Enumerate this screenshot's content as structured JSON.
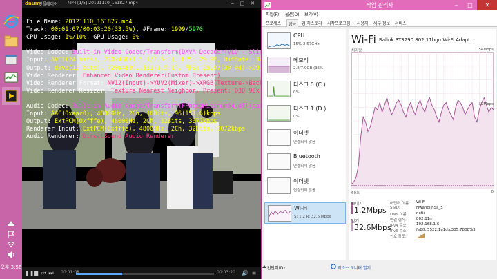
{
  "taskbar": {
    "clock": "오후 3:56"
  },
  "player": {
    "logo": "daum",
    "app_name": "팟플레이어",
    "format": "MP4",
    "file_title": "[1/5] 20121110_161827.mp4",
    "time_current": "00:01:08",
    "time_total": "00:03:20",
    "progress": 0.335,
    "osd": {
      "file_lbl": "File Name: ",
      "file_val": "20121110_161827.mp4",
      "track_lbl": "Track: ",
      "track_val": "00:01:07/00:03:20(33.5%)",
      "frame_lbl": ", #Frame: ",
      "frame_val1": "1999",
      "frame_sep": "/",
      "frame_val2": "5970",
      "cpu_lbl": "CPU Usage: ",
      "cpu_val": "1%/10%",
      "gpu_lbl": ", GPU Usage: ",
      "gpu_val": "0%",
      "vcodec_lbl": "Video Codec: ",
      "vcodec_val": "Built-in Video Codec/Transform(DXVA Decoder(VLD - Slice Short))",
      "vin_lbl": "Input: ",
      "vin_val": "AVC1(24 bits), 720x480(1.5:1/1.5:1), FPS: 29.97, BitRate: 3454kbps",
      "vout_lbl": "Output: ",
      "vout_val": "dxva(12 bits), 720x480(1.5:1/1.5:1), FPS: 29.97(30.04)->29.99",
      "vrend_lbl": "Video Renderer: ",
      "vrend_val": "Enhanced Video Renderer(Custom Present)",
      "vfmt_lbl": "Video Renderer Format: ",
      "vfmt_val": "NV12(Input)->YUV2(Mixer)->XRGB(Texture->BackBuffer->",
      "vres_lbl": "Video Renderer Resizer: ",
      "vres_val": "Texture Nearest Neighbor, Present: D3D 9Ex Discard",
      "acodec_lbl": "Audio Codec: ",
      "acodec_val": "Built-in Audio Codec/Transform(FFmpegMininum64.dll(aac))",
      "ain_lbl": "Input: ",
      "ain_val": "AAC(0xaac0), 48000Hz, 2Ch, 16Bits, 96(151.6)kbps",
      "aout_lbl": "Output: ",
      "aout_val": "ExtPCM(0xfffe), 48000Hz, 2Ch, 32Bits, 3072kbps",
      "arin_lbl": "Renderer Input: ",
      "arin_val": "ExtPCM(0xfffe), 48000Hz, 2Ch, 32Bits, 3072kbps",
      "arend_lbl": "Audio Renderer: ",
      "arend_val": "DirectSound Audio Renderer"
    }
  },
  "taskmgr": {
    "title": "작업 관리자",
    "menu": [
      "파일(F)",
      "옵션(O)",
      "보기(V)"
    ],
    "tabs": [
      "프로세스",
      "성능",
      "앱 히스토리",
      "시작프로그램",
      "사용자",
      "세부 정보",
      "서비스"
    ],
    "active_tab": 1,
    "resources": [
      {
        "name": "CPU",
        "sub": "15% 2.57GHz"
      },
      {
        "name": "메모리",
        "sub": "2.8/7.9GB (35%)"
      },
      {
        "name": "디스크 0 (C:)",
        "sub": "0%"
      },
      {
        "name": "디스크 1 (D:)",
        "sub": "0%"
      },
      {
        "name": "이더넷",
        "sub": "연결되지 않음"
      },
      {
        "name": "Bluetooth",
        "sub": "연결되지 않음"
      },
      {
        "name": "이더넷",
        "sub": "연결되지 않음"
      },
      {
        "name": "Wi-Fi",
        "sub": "S: 1.2  R: 32.6 Mbps"
      }
    ],
    "selected_resource": 7,
    "main": {
      "title": "Wi-Fi",
      "adapter": "Ralink RT3290 802.11bgn Wi-Fi Adapt...",
      "graph_label": "처리량",
      "graph_max": "54Mbps",
      "graph_mid": "32Mbps",
      "graph_time": "60초",
      "graph_min": "0",
      "send_label": "보내기",
      "send_value": "1.2Mbps",
      "recv_label": "받기",
      "recv_value": "32.6Mbps",
      "properties": [
        {
          "k": "어댑터 이름:",
          "v": "Wi-Fi"
        },
        {
          "k": "SSID:",
          "v": "HwangJinSa_5"
        },
        {
          "k": "DNS 이름:",
          "v": "netis"
        },
        {
          "k": "연결 형식:",
          "v": "802.11n"
        },
        {
          "k": "IPv4 주소:",
          "v": "192.168.1.6"
        },
        {
          "k": "IPv6 주소:",
          "v": "fe80::5522:1a1d:c305:7808%3"
        },
        {
          "k": "신호 강도:",
          "v": ""
        }
      ]
    },
    "footer": {
      "less": "간단히(D)",
      "open": "리소스 모니터 열기"
    }
  },
  "colors": {
    "desktop": "#d36ab0",
    "taskmgr_accent": "#a9579a",
    "graph_line": "#a9579a",
    "graph_fill": "#f2e3ee"
  }
}
